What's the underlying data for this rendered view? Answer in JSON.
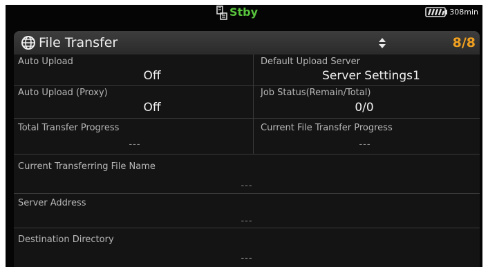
{
  "status_bar": {
    "standby_text": "Stby",
    "battery_text": "308min",
    "colors": {
      "standby": "#58c33d",
      "page_indicator": "#f0a020"
    },
    "icons": [
      "media-icon",
      "battery-icon"
    ]
  },
  "header": {
    "title": "File Transfer",
    "page_indicator": "8/8",
    "icons": [
      "globe-icon",
      "up-down-arrows-icon"
    ]
  },
  "fields": {
    "auto_upload": {
      "label": "Auto Upload",
      "value": "Off"
    },
    "default_upload_server": {
      "label": "Default Upload Server",
      "value": "Server Settings1"
    },
    "auto_upload_proxy": {
      "label": "Auto Upload (Proxy)",
      "value": "Off"
    },
    "job_status": {
      "label": "Job Status(Remain/Total)",
      "value": "0/0"
    },
    "total_transfer_progress": {
      "label": "Total Transfer Progress",
      "value": "---"
    },
    "current_file_transfer_progress": {
      "label": "Current File Transfer Progress",
      "value": "---"
    },
    "current_transferring_file_name": {
      "label": "Current Transferring File Name",
      "value": "---"
    },
    "server_address": {
      "label": "Server Address",
      "value": "---"
    },
    "destination_directory": {
      "label": "Destination Directory",
      "value": "---"
    }
  }
}
